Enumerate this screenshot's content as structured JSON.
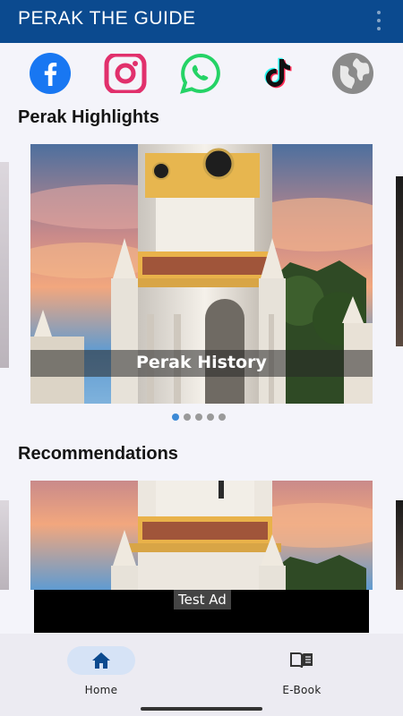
{
  "appbar": {
    "title": "PERAK THE GUIDE"
  },
  "socials": [
    {
      "name": "facebook-icon",
      "color": "#1877f2"
    },
    {
      "name": "instagram-icon",
      "color": "#e1306c"
    },
    {
      "name": "whatsapp-icon",
      "color": "#25d366"
    },
    {
      "name": "tiktok-icon",
      "color": "#000000"
    },
    {
      "name": "globe-icon",
      "color": "#808080"
    }
  ],
  "highlights": {
    "title": "Perak Highlights",
    "caption": "Perak History",
    "slide_count": 5,
    "active_slide": 1
  },
  "recommendations": {
    "title": "Recommendations"
  },
  "ad": {
    "label": "Test Ad"
  },
  "bottom_nav": {
    "items": [
      {
        "label": "Home",
        "icon": "home-icon",
        "active": true
      },
      {
        "label": "E-Book",
        "icon": "book-open-icon",
        "active": false
      }
    ]
  },
  "colors": {
    "appbar": "#0b4a8f",
    "active_dot": "#3c8ad6",
    "nav_active_pill": "#d6e3f6"
  }
}
